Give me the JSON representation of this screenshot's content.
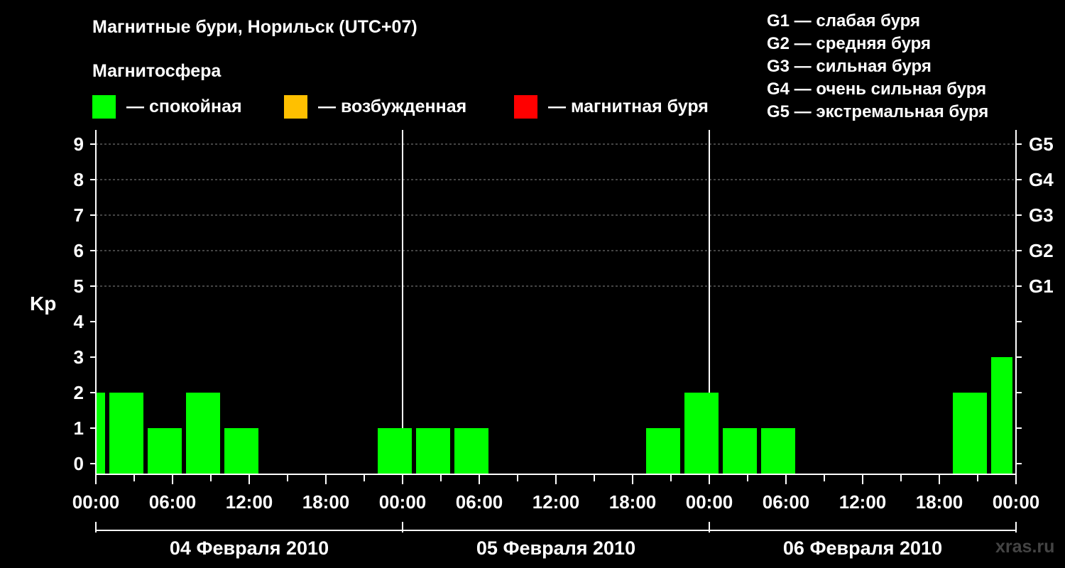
{
  "header": {
    "title": "Магнитные бури, Норильск (UTC+07)",
    "subtitle": "Магнитосфера"
  },
  "state_legend": [
    {
      "label": "— спокойная",
      "color": "#00ff00"
    },
    {
      "label": "— возбужденная",
      "color": "#ffc000"
    },
    {
      "label": "— магнитная буря",
      "color": "#ff0000"
    }
  ],
  "g_legend": [
    "G1 — слабая буря",
    "G2 — средняя буря",
    "G3 — сильная буря",
    "G4 — очень сильная буря",
    "G5 — экстремальная буря"
  ],
  "credit": "xras.ru",
  "chart_data": {
    "type": "bar",
    "ylabel": "Kp",
    "ylim": [
      -0.3,
      9.4
    ],
    "y_ticks": [
      "0",
      "1",
      "2",
      "3",
      "4",
      "5",
      "6",
      "7",
      "8",
      "9"
    ],
    "g_ticks": [
      {
        "label": "G1",
        "kp": 5
      },
      {
        "label": "G2",
        "kp": 6
      },
      {
        "label": "G3",
        "kp": 7
      },
      {
        "label": "G4",
        "kp": 8
      },
      {
        "label": "G5",
        "kp": 9
      }
    ],
    "x_tick_labels": [
      "00:00",
      "06:00",
      "12:00",
      "18:00",
      "00:00",
      "06:00",
      "12:00",
      "18:00",
      "00:00",
      "06:00",
      "12:00",
      "18:00",
      "00:00"
    ],
    "date_labels": [
      "04 Февраля 2010",
      "05 Февраля 2010",
      "06 Февраля 2010"
    ],
    "bar_color": "#00ff00",
    "grid": true,
    "bars": [
      {
        "start": "2010-02-04 00:00",
        "end": "2010-02-04 01:00",
        "kp": 2
      },
      {
        "start": "2010-02-04 01:00",
        "end": "2010-02-04 04:00",
        "kp": 2
      },
      {
        "start": "2010-02-04 04:00",
        "end": "2010-02-04 07:00",
        "kp": 1
      },
      {
        "start": "2010-02-04 07:00",
        "end": "2010-02-04 10:00",
        "kp": 2
      },
      {
        "start": "2010-02-04 10:00",
        "end": "2010-02-04 13:00",
        "kp": 1
      },
      {
        "start": "2010-02-04 13:00",
        "end": "2010-02-04 16:00",
        "kp": 0
      },
      {
        "start": "2010-02-04 16:00",
        "end": "2010-02-04 19:00",
        "kp": 0
      },
      {
        "start": "2010-02-04 19:00",
        "end": "2010-02-04 22:00",
        "kp": 0
      },
      {
        "start": "2010-02-04 22:00",
        "end": "2010-02-05 01:00",
        "kp": 1
      },
      {
        "start": "2010-02-05 01:00",
        "end": "2010-02-05 04:00",
        "kp": 1
      },
      {
        "start": "2010-02-05 04:00",
        "end": "2010-02-05 07:00",
        "kp": 1
      },
      {
        "start": "2010-02-05 07:00",
        "end": "2010-02-05 10:00",
        "kp": 0
      },
      {
        "start": "2010-02-05 10:00",
        "end": "2010-02-05 13:00",
        "kp": 0
      },
      {
        "start": "2010-02-05 13:00",
        "end": "2010-02-05 16:00",
        "kp": 0
      },
      {
        "start": "2010-02-05 16:00",
        "end": "2010-02-05 19:00",
        "kp": 0
      },
      {
        "start": "2010-02-05 19:00",
        "end": "2010-02-05 22:00",
        "kp": 1
      },
      {
        "start": "2010-02-05 22:00",
        "end": "2010-02-06 01:00",
        "kp": 2
      },
      {
        "start": "2010-02-06 01:00",
        "end": "2010-02-06 04:00",
        "kp": 1
      },
      {
        "start": "2010-02-06 04:00",
        "end": "2010-02-06 07:00",
        "kp": 1
      },
      {
        "start": "2010-02-06 07:00",
        "end": "2010-02-06 10:00",
        "kp": 0
      },
      {
        "start": "2010-02-06 10:00",
        "end": "2010-02-06 13:00",
        "kp": 0
      },
      {
        "start": "2010-02-06 13:00",
        "end": "2010-02-06 16:00",
        "kp": 0
      },
      {
        "start": "2010-02-06 16:00",
        "end": "2010-02-06 19:00",
        "kp": 0
      },
      {
        "start": "2010-02-06 19:00",
        "end": "2010-02-06 22:00",
        "kp": 2
      },
      {
        "start": "2010-02-06 22:00",
        "end": "2010-02-07 00:00",
        "kp": 3
      }
    ]
  }
}
